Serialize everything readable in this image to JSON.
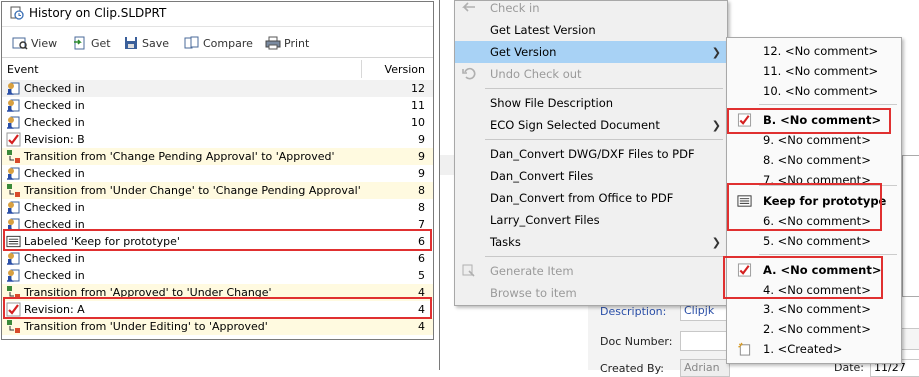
{
  "history": {
    "title": "History on Clip.SLDPRT",
    "toolbar": {
      "view": "View",
      "get": "Get",
      "save": "Save",
      "compare": "Compare",
      "print": "Print"
    },
    "columns": {
      "event": "Event",
      "version": "Version"
    },
    "rows": [
      {
        "event": "Checked in",
        "version": "12",
        "icon": "checked-in-icon"
      },
      {
        "event": "Checked in",
        "version": "11",
        "icon": "checked-in-icon"
      },
      {
        "event": "Checked in",
        "version": "10",
        "icon": "checked-in-icon"
      },
      {
        "event": "Revision: B",
        "version": "9",
        "icon": "revision-icon"
      },
      {
        "event": "Transition from 'Change Pending Approval' to 'Approved'",
        "version": "9",
        "icon": "transition-icon"
      },
      {
        "event": "Checked in",
        "version": "9",
        "icon": "checked-in-icon"
      },
      {
        "event": "Transition from 'Under Change' to 'Change Pending Approval'",
        "version": "8",
        "icon": "transition-icon"
      },
      {
        "event": "Checked in",
        "version": "8",
        "icon": "checked-in-icon"
      },
      {
        "event": "Checked in",
        "version": "7",
        "icon": "checked-in-icon"
      },
      {
        "event": "Labeled 'Keep for prototype'",
        "version": "6",
        "icon": "label-icon"
      },
      {
        "event": "Checked in",
        "version": "6",
        "icon": "checked-in-icon"
      },
      {
        "event": "Checked in",
        "version": "5",
        "icon": "checked-in-icon"
      },
      {
        "event": "Transition from 'Approved' to 'Under Change'",
        "version": "4",
        "icon": "transition-icon"
      },
      {
        "event": "Revision: A",
        "version": "4",
        "icon": "revision-icon"
      },
      {
        "event": "Transition from 'Under Editing' to 'Approved'",
        "version": "4",
        "icon": "transition-icon"
      }
    ]
  },
  "context_menu": {
    "items": [
      {
        "label": "Check in",
        "disabled": true
      },
      {
        "label": "Get Latest Version",
        "disabled": false
      },
      {
        "label": "Get Version",
        "disabled": false,
        "highlighted": true,
        "submenu": true
      },
      {
        "label": "Undo Check out",
        "disabled": true
      },
      {
        "label": "Show File Description",
        "disabled": false
      },
      {
        "label": "ECO Sign Selected Document",
        "disabled": false,
        "submenu": true
      },
      {
        "label": "Dan_Convert DWG/DXF Files to PDF",
        "disabled": false
      },
      {
        "label": "Dan_Convert Files",
        "disabled": false
      },
      {
        "label": "Dan_Convert from Office to PDF",
        "disabled": false
      },
      {
        "label": "Larry_Convert Files",
        "disabled": false
      },
      {
        "label": "Tasks",
        "disabled": false,
        "submenu": true
      },
      {
        "label": "Generate Item",
        "disabled": true
      },
      {
        "label": "Browse to item",
        "disabled": true
      }
    ]
  },
  "submenu": {
    "items": [
      {
        "label": "12. <No comment>"
      },
      {
        "label": "11. <No comment>"
      },
      {
        "label": "10. <No comment>"
      },
      {
        "label": "B. <No comment>",
        "bold": true
      },
      {
        "label": "9. <No comment>"
      },
      {
        "label": "8. <No comment>"
      },
      {
        "label": "7. <No comment>"
      },
      {
        "label": "Keep for prototype",
        "bold": true
      },
      {
        "label": "6. <No comment>"
      },
      {
        "label": "5. <No comment>"
      },
      {
        "label": "A. <No comment>",
        "bold": true
      },
      {
        "label": "4. <No comment>"
      },
      {
        "label": "3. <No comment>"
      },
      {
        "label": "2. <No comment>"
      },
      {
        "label": "1. <Created>"
      }
    ]
  },
  "background_form": {
    "description_label": "Description:",
    "description_value": "Clipjk",
    "doc_number_label": "Doc Number:",
    "created_by_label": "Created By:",
    "created_by_value": "Adrian",
    "date_label": "Date:",
    "date_value": "11/27"
  },
  "colors": {
    "highlight": "#a8d2f5",
    "annotation_box": "#e03030",
    "revision_check": "#d42020"
  }
}
